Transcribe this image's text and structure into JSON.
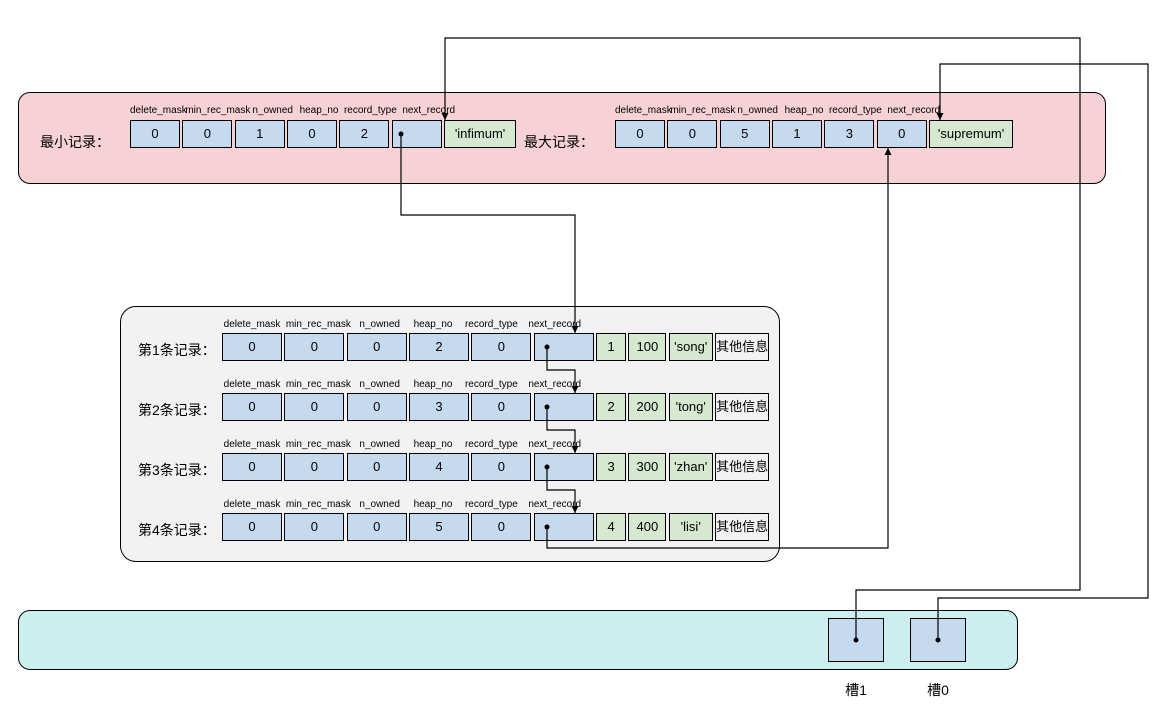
{
  "topBox": {
    "min": {
      "label": "最小记录：",
      "headers": [
        "delete_mask",
        "min_rec_mask",
        "n_owned",
        "heap_no",
        "record_type",
        "next_record"
      ],
      "cells": [
        "0",
        "0",
        "1",
        "0",
        "2",
        ""
      ],
      "tail": "'infimum'"
    },
    "max": {
      "label": "最大记录：",
      "headers": [
        "delete_mask",
        "min_rec_mask",
        "n_owned",
        "heap_no",
        "record_type",
        "next_record"
      ],
      "cells": [
        "0",
        "0",
        "5",
        "1",
        "3",
        "0"
      ],
      "tail": "'supremum'"
    }
  },
  "records": {
    "headers": [
      "delete_mask",
      "min_rec_mask",
      "n_owned",
      "heap_no",
      "record_type",
      "next_record"
    ],
    "rows": [
      {
        "label": "第1条记录：",
        "cells": [
          "0",
          "0",
          "0",
          "2",
          "0",
          ""
        ],
        "data": [
          "1",
          "100",
          "'song'"
        ],
        "extra": "其他信息"
      },
      {
        "label": "第2条记录：",
        "cells": [
          "0",
          "0",
          "0",
          "3",
          "0",
          ""
        ],
        "data": [
          "2",
          "200",
          "'tong'"
        ],
        "extra": "其他信息"
      },
      {
        "label": "第3条记录：",
        "cells": [
          "0",
          "0",
          "0",
          "4",
          "0",
          ""
        ],
        "data": [
          "3",
          "300",
          "'zhan'"
        ],
        "extra": "其他信息"
      },
      {
        "label": "第4条记录：",
        "cells": [
          "0",
          "0",
          "0",
          "5",
          "0",
          ""
        ],
        "data": [
          "4",
          "400",
          "'lisi'"
        ],
        "extra": "其他信息"
      }
    ]
  },
  "slots": {
    "s1": "槽1",
    "s0": "槽0"
  }
}
